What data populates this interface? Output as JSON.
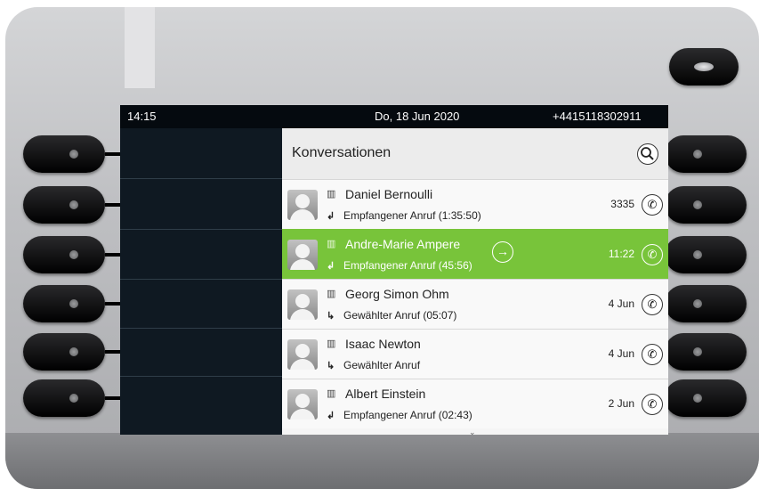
{
  "status_bar": {
    "time": "14:15",
    "date": "Do, 18 Jun 2020",
    "number": "+4415118302911"
  },
  "panel": {
    "title": "Konversationen",
    "search_icon": "search-icon"
  },
  "conversations": [
    {
      "name": "Daniel Bernoulli",
      "direction_icon": "incoming-call-icon",
      "direction_glyph": "↲",
      "detail": "Empfangener Anruf (1:35:50)",
      "time": "3335",
      "selected": false
    },
    {
      "name": "Andre-Marie Ampere",
      "direction_icon": "incoming-call-icon",
      "direction_glyph": "↲",
      "detail": "Empfangener Anruf (45:56)",
      "time": "11:22",
      "selected": true
    },
    {
      "name": "Georg Simon Ohm",
      "direction_icon": "outgoing-call-icon",
      "direction_glyph": "↳",
      "detail": "Gewählter Anruf (05:07)",
      "time": "4 Jun",
      "selected": false
    },
    {
      "name": "Isaac Newton",
      "direction_icon": "outgoing-call-icon",
      "direction_glyph": "↳",
      "detail": "Gewählter Anruf",
      "time": "4 Jun",
      "selected": false
    },
    {
      "name": "Albert Einstein",
      "direction_icon": "incoming-call-icon",
      "direction_glyph": "↲",
      "detail": "Empfangener Anruf (02:43)",
      "time": "2 Jun",
      "selected": false
    }
  ],
  "colors": {
    "accent": "#78c43a",
    "screen_bg": "#101820",
    "list_bg": "#f9f9f9"
  }
}
